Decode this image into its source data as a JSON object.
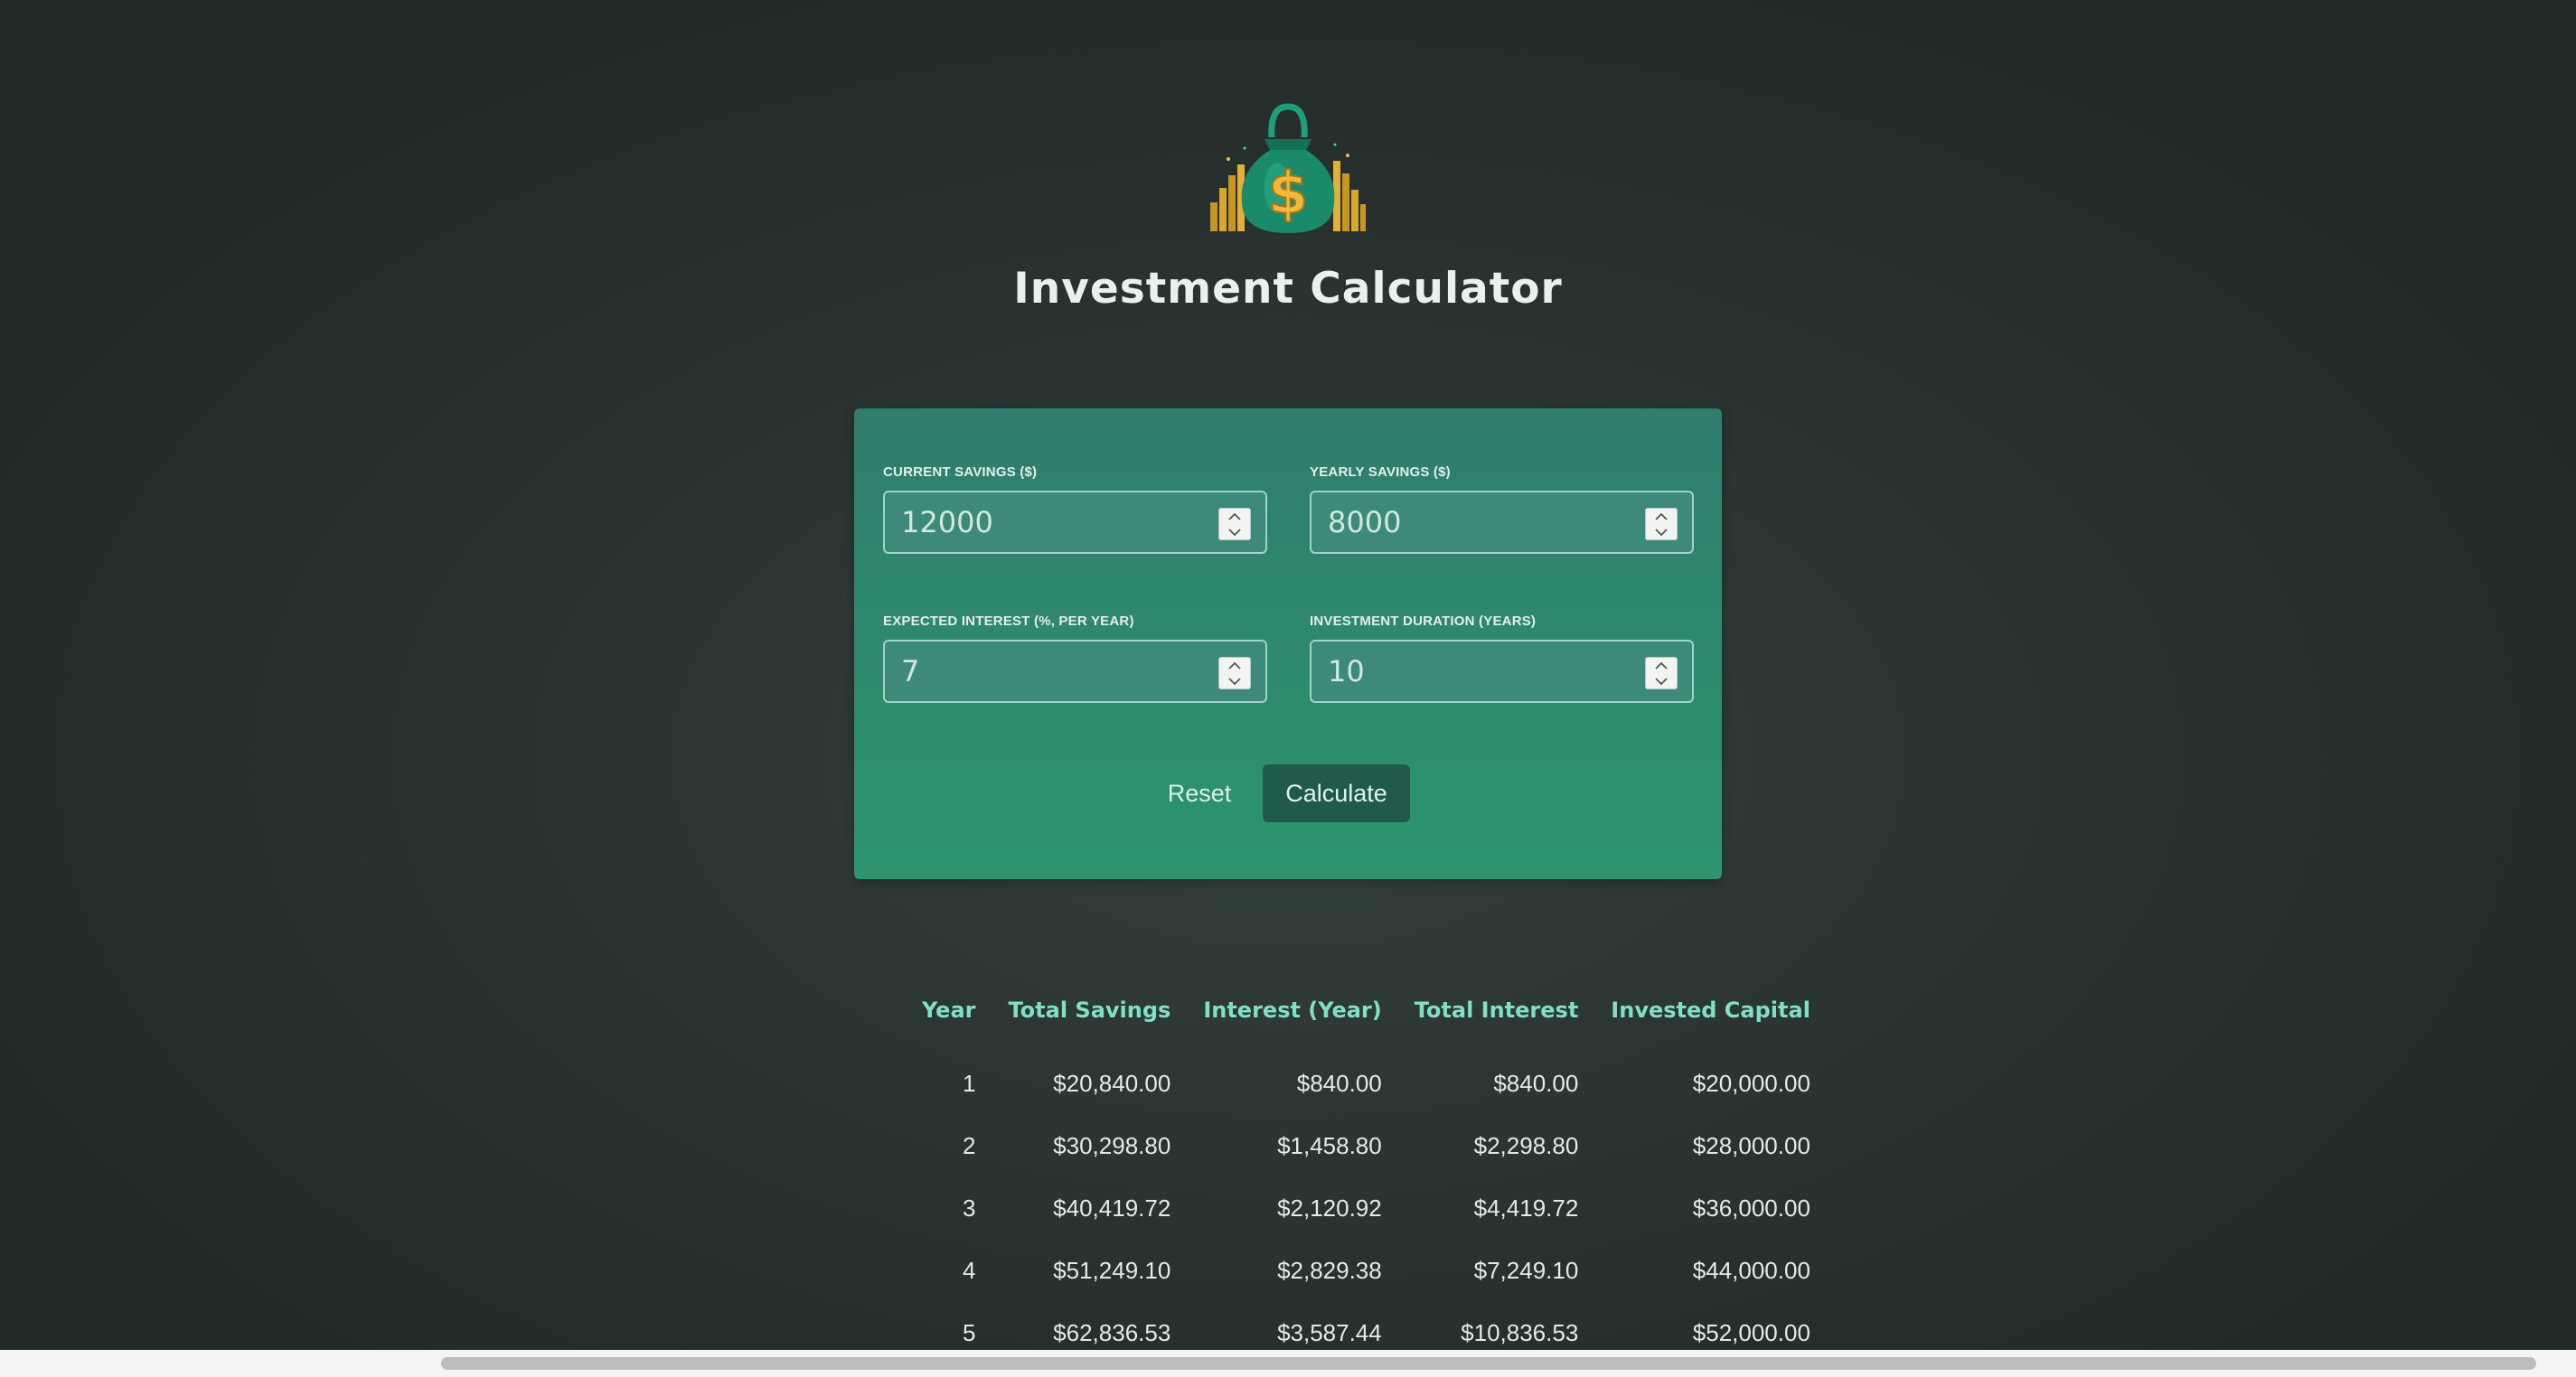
{
  "app": {
    "title": "Investment Calculator",
    "logo_icon": "money-bag-dollar-icon"
  },
  "form": {
    "fields": [
      {
        "label": "Current Savings ($)",
        "value": "12000"
      },
      {
        "label": "Yearly Savings ($)",
        "value": "8000"
      },
      {
        "label": "Expected Interest (%, per year)",
        "value": "7"
      },
      {
        "label": "Investment Duration (years)",
        "value": "10"
      }
    ],
    "reset_label": "Reset",
    "calculate_label": "Calculate"
  },
  "results": {
    "headers": [
      "Year",
      "Total Savings",
      "Interest (Year)",
      "Total Interest",
      "Invested Capital"
    ],
    "rows": [
      [
        "1",
        "$20,840.00",
        "$840.00",
        "$840.00",
        "$20,000.00"
      ],
      [
        "2",
        "$30,298.80",
        "$1,458.80",
        "$2,298.80",
        "$28,000.00"
      ],
      [
        "3",
        "$40,419.72",
        "$2,120.92",
        "$4,419.72",
        "$36,000.00"
      ],
      [
        "4",
        "$51,249.10",
        "$2,829.38",
        "$7,249.10",
        "$44,000.00"
      ],
      [
        "5",
        "$62,836.53",
        "$3,587.44",
        "$10,836.53",
        "$52,000.00"
      ]
    ]
  },
  "colors": {
    "background": "#2b3532",
    "card_top": "#307c6e",
    "card_bottom": "#2c956e",
    "header_text": "#7fe0c6",
    "calculate_button": "#1f5a4d"
  }
}
